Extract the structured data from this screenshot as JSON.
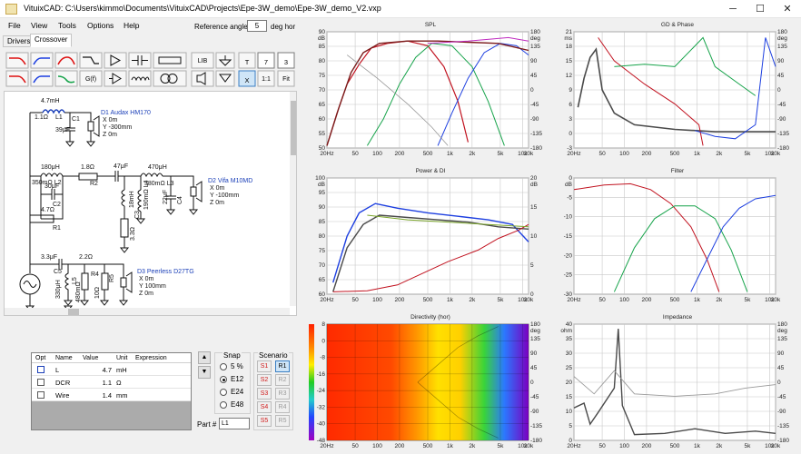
{
  "window": {
    "title": "VituixCAD: C:\\Users\\kimmo\\Documents\\VituixCAD\\Projects\\Epe-3W_demo\\Epe-3W_demo_V2.vxp",
    "min_icon": "minimize-icon",
    "max_icon": "maximize-icon",
    "close_icon": "close-icon",
    "min_glyph": "─",
    "max_glyph": "☐",
    "close_glyph": "✕"
  },
  "menu": [
    "File",
    "View",
    "Tools",
    "Options",
    "Help"
  ],
  "reference": {
    "label": "Reference angle",
    "value": "5",
    "unit": "deg hor"
  },
  "tabs": [
    "Drivers",
    "Crossover"
  ],
  "toolbar": {
    "text_buttons": [
      "LIB",
      "T",
      "7",
      "3",
      "X",
      "1:1",
      "Fit"
    ],
    "gx_label": "G(f)"
  },
  "schematic": {
    "labels": [
      "4.7mH",
      "1.1Ω",
      "L1",
      "C1",
      "39μF",
      "D1 Audax HM170",
      "X 0m",
      "Y -300mm",
      "Z 0m",
      "180μH",
      "350mΩ L2",
      "1.8Ω",
      "R2",
      "47μF",
      "470μH",
      "190mΩ L4",
      "380mΩ L3",
      "18mH",
      "C3",
      "22μF",
      "C4",
      "30μF",
      "C2",
      "4.7Ω",
      "R1",
      "3.3Ω",
      "D2 Vifa M10MD",
      "X 0m",
      "Y -100mm",
      "Z 0m",
      "3.3μF",
      "C5",
      "2.2Ω",
      "R4",
      "10Ω",
      "R5",
      "330μH",
      "L5",
      "480mΩ",
      "D3 Peerless D27TG",
      "X 0m",
      "Y 100mm",
      "Z 0m"
    ]
  },
  "params": {
    "headers": [
      "Opt",
      "Name",
      "Value",
      "Unit",
      "Expression"
    ],
    "rows": [
      {
        "name": "L",
        "value": "4.7",
        "unit": "mH",
        "expr": ""
      },
      {
        "name": "DCR",
        "value": "1.1",
        "unit": "Ω",
        "expr": ""
      },
      {
        "name": "Wire",
        "value": "1.4",
        "unit": "mm",
        "expr": ""
      }
    ],
    "up": "▲",
    "down": "▼"
  },
  "snap": {
    "title": "Snap",
    "options": [
      "5 %",
      "E12",
      "E24",
      "E48"
    ],
    "selected": "E12"
  },
  "scenario": {
    "title": "Scenario",
    "s": [
      "S1",
      "S2",
      "S3",
      "S4",
      "S5"
    ],
    "r": [
      "R1",
      "R2",
      "R3",
      "R4",
      "R5"
    ],
    "selected": "R1"
  },
  "part": {
    "label": "Part #",
    "value": "L1"
  },
  "colors": {
    "accent": "#1b3fb8",
    "woofer": "#c1121f",
    "mid": "#16a34a",
    "tweeter": "#1d3fe0",
    "sum": "#4a4a4a"
  },
  "charts": {
    "spl": {
      "title": "SPL",
      "yl": [
        "90",
        "85",
        "80",
        "75",
        "70",
        "65",
        "60",
        "55",
        "50"
      ],
      "yr": [
        "180",
        "135",
        "90",
        "45",
        "0",
        "-45",
        "-90",
        "-135",
        "-180"
      ],
      "yl_unit": "dB",
      "yr_unit": "deg",
      "x": [
        "20Hz",
        "50",
        "100",
        "200",
        "500",
        "1k",
        "2k",
        "5k",
        "10k",
        "20k"
      ]
    },
    "gd": {
      "title": "GD & Phase",
      "yl": [
        "21",
        "18",
        "15",
        "12",
        "9",
        "6",
        "3",
        "0",
        "-3"
      ],
      "yr": [
        "180",
        "135",
        "90",
        "45",
        "0",
        "-45",
        "-90",
        "-135",
        "-180"
      ],
      "yl_unit": "ms",
      "yr_unit": "deg",
      "x": [
        "20Hz",
        "50",
        "100",
        "200",
        "500",
        "1k",
        "2k",
        "5k",
        "10k",
        "20k"
      ]
    },
    "power": {
      "title": "Power & DI",
      "yl": [
        "100",
        "95",
        "90",
        "85",
        "80",
        "75",
        "70",
        "65",
        "60"
      ],
      "yr": [
        "20",
        "",
        "15",
        "",
        "10",
        "",
        "5",
        "",
        "0"
      ],
      "yl_unit": "dB",
      "yr_unit": "dB",
      "x": [
        "20Hz",
        "50",
        "100",
        "200",
        "500",
        "1k",
        "2k",
        "5k",
        "10k",
        "20k"
      ]
    },
    "filter": {
      "title": "Filter",
      "yl": [
        "0",
        "-5",
        "-10",
        "-15",
        "-20",
        "-25",
        "-30"
      ],
      "yr": [],
      "yl_unit": "dB",
      "yr_unit": "",
      "x": [
        "20Hz",
        "50",
        "100",
        "200",
        "500",
        "1k",
        "2k",
        "5k",
        "10k",
        "20k"
      ]
    },
    "directivity": {
      "title": "Directivity (hor)",
      "yl": [
        "8",
        "0",
        "-8",
        "-16",
        "-24",
        "-32",
        "-40",
        "-48"
      ],
      "yr": [
        "180",
        "135",
        "90",
        "45",
        "0",
        "-45",
        "-90",
        "-135",
        "-180"
      ],
      "yl_unit": "",
      "yr_unit": "deg",
      "x": [
        "20Hz",
        "50",
        "100",
        "200",
        "500",
        "1k",
        "2k",
        "5k",
        "10k",
        "20k"
      ]
    },
    "impedance": {
      "title": "Impedance",
      "yl": [
        "40",
        "35",
        "30",
        "25",
        "20",
        "15",
        "10",
        "5",
        "0"
      ],
      "yr": [
        "180",
        "135",
        "90",
        "45",
        "0",
        "-45",
        "-90",
        "-135",
        "-180"
      ],
      "yl_unit": "ohm",
      "yr_unit": "deg",
      "x": [
        "20Hz",
        "50",
        "100",
        "200",
        "500",
        "1k",
        "2k",
        "5k",
        "10k",
        "20k"
      ]
    }
  }
}
